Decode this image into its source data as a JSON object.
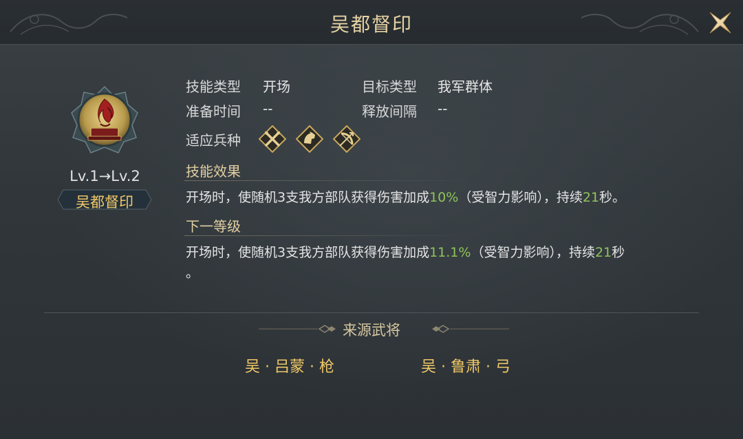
{
  "header": {
    "title": "吴都督印"
  },
  "skill": {
    "level_text": "Lv.1→Lv.2",
    "name": "吴都督印"
  },
  "info": {
    "skill_type_label": "技能类型",
    "skill_type_value": "开场",
    "target_type_label": "目标类型",
    "target_type_value": "我军群体",
    "prep_time_label": "准备时间",
    "prep_time_value": "--",
    "interval_label": "释放间隔",
    "interval_value": "--",
    "troop_label": "适应兵种",
    "troop_icons": [
      "spear-troop-icon",
      "cavalry-troop-icon",
      "archer-troop-icon"
    ]
  },
  "effect": {
    "title": "技能效果",
    "pre": "开场时，使随机3支我方部队获得伤害加成",
    "value": "10%",
    "mid": "（受智力影响），持续",
    "duration": "21",
    "post": "秒。"
  },
  "next_level": {
    "title": "下一等级",
    "pre": "开场时，使随机3支我方部队获得伤害加成",
    "value": "11.1%",
    "mid": "（受智力影响），持续",
    "duration": "21",
    "post": "秒",
    "line2": "。"
  },
  "source": {
    "title": "来源武将",
    "generals": [
      "吴 · 吕蒙 · 枪",
      "吴 · 鲁肃 · 弓"
    ]
  },
  "colors": {
    "title_gold": "#e6d3a4",
    "name_gold": "#f2c969",
    "highlight_green": "#8fc45a"
  }
}
